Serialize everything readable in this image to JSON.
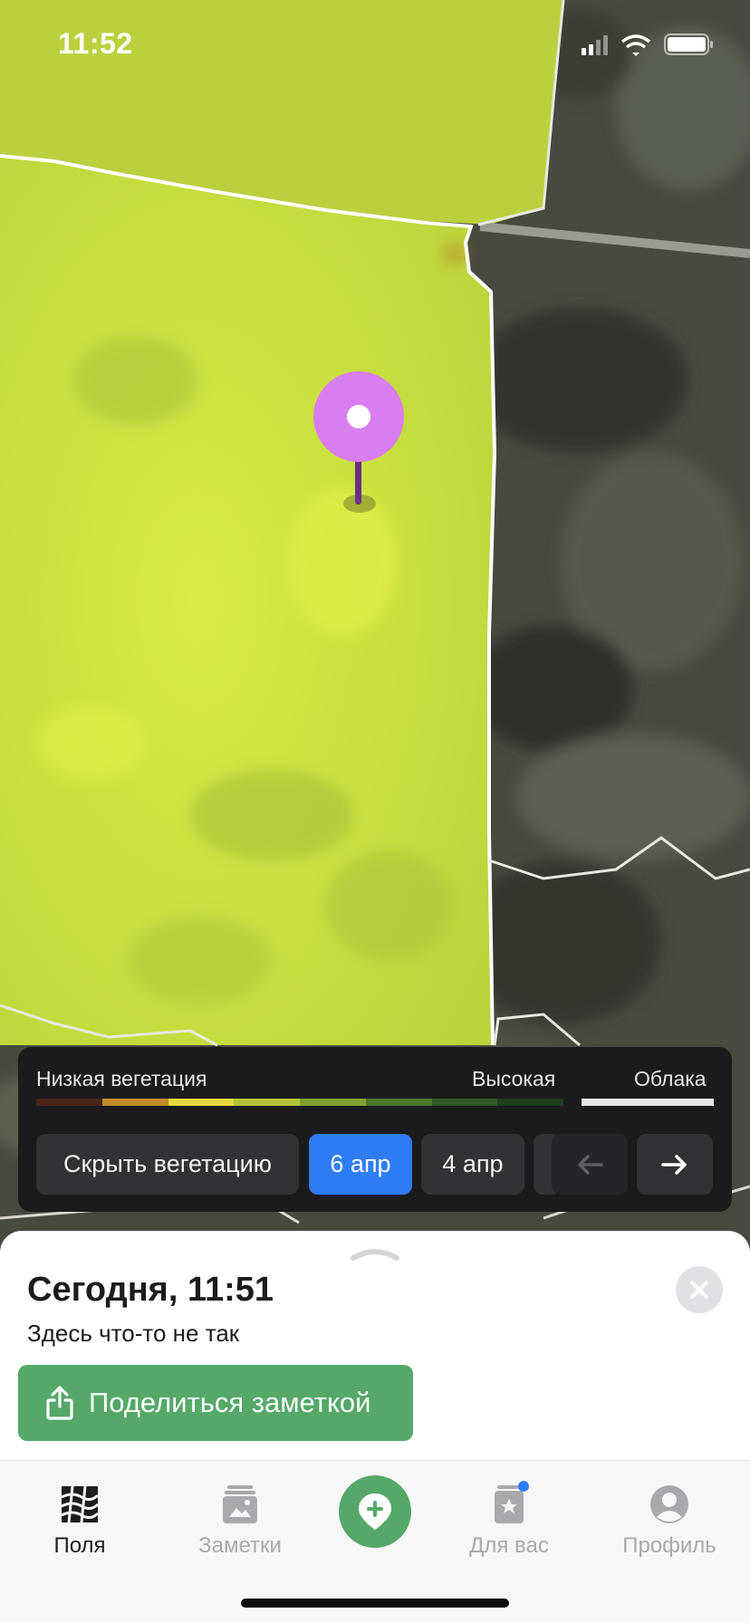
{
  "status_bar": {
    "time": "11:52"
  },
  "legend": {
    "low_label": "Низкая вегетация",
    "high_label": "Высокая",
    "clouds_label": "Облака",
    "scale_colors": [
      "#4a2417",
      "#c28b2a",
      "#e3d93a",
      "#b5c43a",
      "#7fa232",
      "#4d7a2a",
      "#2f5a24",
      "#1f3f1c"
    ],
    "cloud_color": "#e6e6e6"
  },
  "controls": {
    "hide_vegetation": "Скрыть вегетацию",
    "dates": [
      "6 апр",
      "4 апр"
    ],
    "selected_date": "6 апр"
  },
  "note": {
    "title": "Сегодня, 11:51",
    "text": "Здесь что-то не так",
    "share_button": "Поделиться заметкой"
  },
  "tabs": [
    {
      "label": "Поля",
      "icon": "fields-icon",
      "active": true
    },
    {
      "label": "Заметки",
      "icon": "notes-icon",
      "active": false
    },
    {
      "label": "add-note",
      "icon": "add-location-icon",
      "active": false
    },
    {
      "label": "Для вас",
      "icon": "for-you-icon",
      "active": false,
      "badge": true
    },
    {
      "label": "Профиль",
      "icon": "profile-icon",
      "active": false
    }
  ],
  "colors": {
    "accent_green": "#55a868",
    "accent_blue": "#2f7df6",
    "pin": "#d97ef0",
    "field_fill": "#c4dd3f"
  }
}
